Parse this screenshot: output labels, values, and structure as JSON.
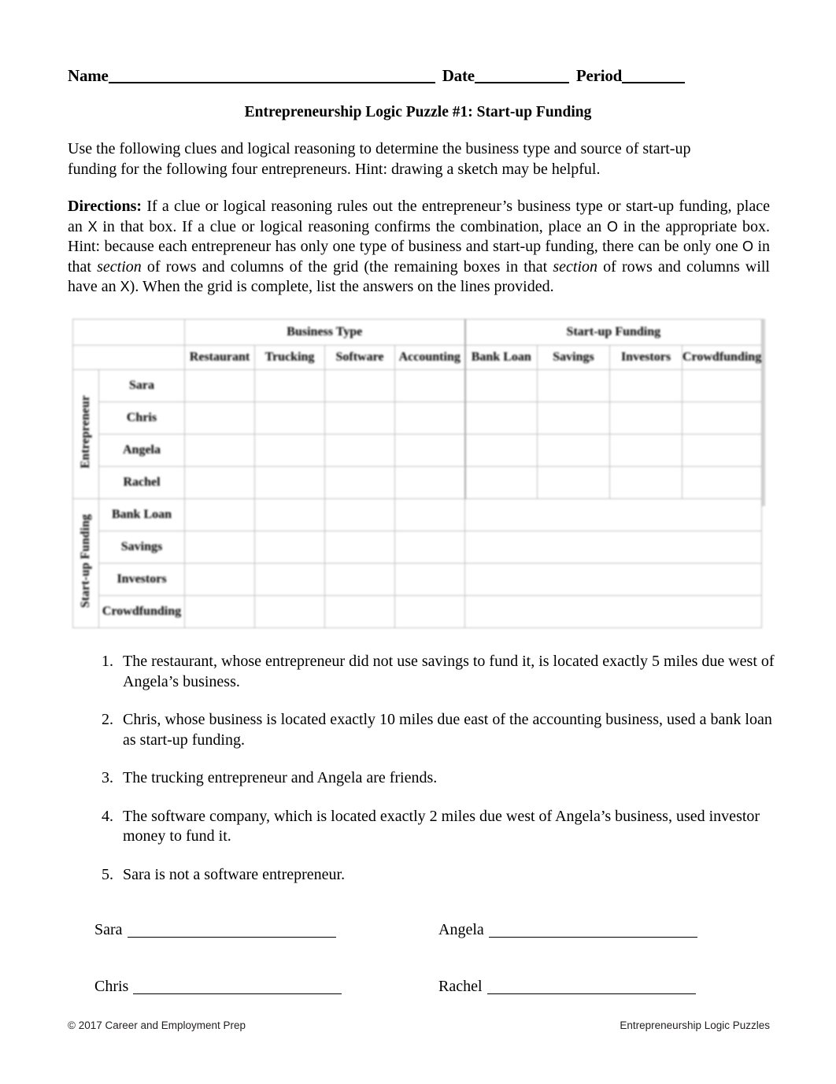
{
  "header": {
    "name_label": "Name",
    "date_label": "Date",
    "period_label": "Period"
  },
  "title": "Entrepreneurship Logic Puzzle #1: Start-up Funding",
  "intro": "Use the following clues and logical reasoning to determine the business type and source of start-up funding for the following four entrepreneurs. Hint: drawing a sketch may be helpful.",
  "directions": {
    "label": "Directions:",
    "part1": " If a clue or logical reasoning rules out the entrepreneur’s business type or start-up funding, place an ",
    "mark_x": "X",
    "part2": " in that box. If a clue or logical reasoning confirms the combination, place an ",
    "mark_o": "O",
    "part3": " in the appropriate box. Hint: because each entrepreneur has only one type of business and start-up funding, there can be only one ",
    "mark_o2": "O",
    "part4": " in that ",
    "em1": "section",
    "part5": " of rows and columns of the grid (the remaining boxes in that ",
    "em2": "section",
    "part6": " of rows and columns will have an ",
    "mark_x2": "X",
    "part7": "). When the grid is complete, list the answers on the lines provided."
  },
  "grid": {
    "group_headers": [
      "Business Type",
      "Start-up Funding"
    ],
    "column_headers": [
      "Restaurant",
      "Trucking",
      "Software",
      "Accounting",
      "Bank Loan",
      "Savings",
      "Investors",
      "Crowdfunding"
    ],
    "row_group_labels": [
      "Entrepreneur",
      "Start-up Funding"
    ],
    "entrepreneur_rows": [
      "Sara",
      "Chris",
      "Angela",
      "Rachel"
    ],
    "funding_rows": [
      "Bank Loan",
      "Savings",
      "Investors",
      "Crowdfunding"
    ]
  },
  "clues": [
    {
      "num": "1.",
      "text": "The restaurant, whose entrepreneur did not use savings to fund it, is located exactly 5 miles due west of Angela’s business."
    },
    {
      "num": "2.",
      "text": "Chris, whose business is located exactly 10 miles due east of the accounting business, used a bank loan as start-up funding."
    },
    {
      "num": "3.",
      "text": "The trucking entrepreneur and Angela are friends."
    },
    {
      "num": "4.",
      "text": "The software company, which is located exactly 2 miles due west of Angela’s business, used investor money to fund it."
    },
    {
      "num": "5.",
      "text": "Sara is not a software entrepreneur."
    }
  ],
  "answers": [
    {
      "left": "Sara",
      "right": "Angela"
    },
    {
      "left": "Chris",
      "right": "Rachel"
    }
  ],
  "footer": {
    "left": "© 2017 Career and Employment Prep",
    "right": "Entrepreneurship Logic Puzzles"
  }
}
